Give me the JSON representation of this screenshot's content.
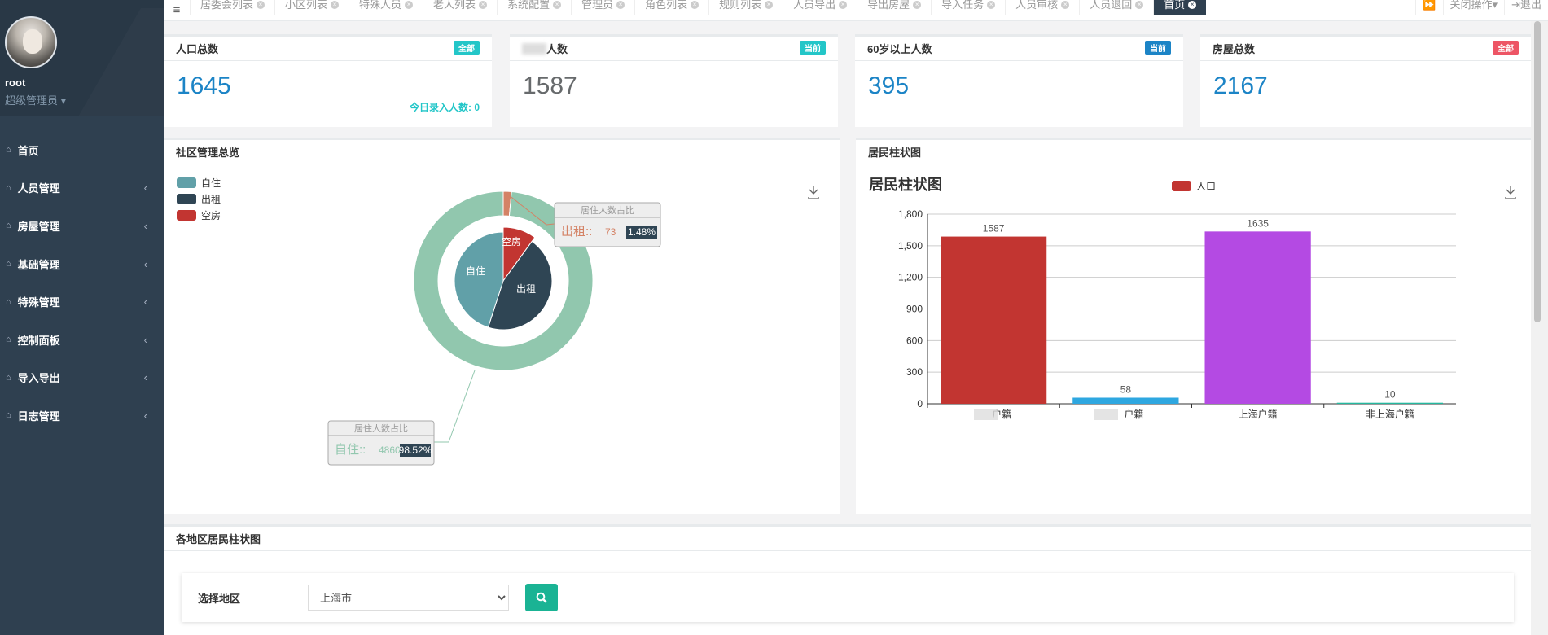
{
  "user": {
    "name": "root",
    "role": "超级管理员"
  },
  "nav": [
    {
      "label": "首页",
      "arrow": false
    },
    {
      "label": "人员管理",
      "arrow": true
    },
    {
      "label": "房屋管理",
      "arrow": true
    },
    {
      "label": "基础管理",
      "arrow": true
    },
    {
      "label": "特殊管理",
      "arrow": true
    },
    {
      "label": "控制面板",
      "arrow": true
    },
    {
      "label": "导入导出",
      "arrow": true
    },
    {
      "label": "日志管理",
      "arrow": true
    }
  ],
  "tabs": [
    "居委会列表",
    "小区列表",
    "特殊人员",
    "老人列表",
    "系统配置",
    "管理员",
    "角色列表",
    "规则列表",
    "人员导出",
    "导出房屋",
    "导入任务",
    "人员审核",
    "人员退回",
    "首页"
  ],
  "tab_tools": {
    "close_ops": "关闭操作",
    "logout": "退出"
  },
  "stats": [
    {
      "title": "人口总数",
      "badge": "全部",
      "badge_color": "#23c6c8",
      "value": "1645",
      "value_color": "#1c84c6",
      "sub": "今日录入人数:  0"
    },
    {
      "title": "人数",
      "badge": "当前",
      "badge_color": "#23c6c8",
      "value": "1587",
      "value_color": "#676a6c"
    },
    {
      "title": "60岁以上人数",
      "badge": "当前",
      "badge_color": "#1c84c6",
      "value": "395",
      "value_color": "#1c84c6"
    },
    {
      "title": "房屋总数",
      "badge": "全部",
      "badge_color": "#ed5565",
      "value": "2167",
      "value_color": "#1c84c6"
    }
  ],
  "panel_left": {
    "title": "社区管理总览"
  },
  "panel_right": {
    "title": "居民柱状图"
  },
  "panel_bottom": {
    "title": "各地区居民柱状图",
    "filter_label": "选择地区",
    "region": "上海市"
  },
  "chart_data": [
    {
      "type": "pie",
      "legend": [
        "自住",
        "出租",
        "空房"
      ],
      "colors": {
        "自住": "#61a0a8",
        "出租": "#2f4554",
        "空房": "#c23531",
        "outer": "#91c7ae",
        "outer_small": "#d48265"
      },
      "inner_labels": [
        "自住",
        "出租",
        "空房"
      ],
      "callouts": [
        {
          "title": "居住人数占比",
          "name": "出租::",
          "value": "73",
          "pct": "1.48%"
        },
        {
          "title": "居住人数占比",
          "name": "自住::",
          "value": "4860",
          "pct": "98.52%"
        }
      ],
      "outer_values": [
        4860,
        73
      ],
      "inner_values_estimated": [
        45,
        45,
        10
      ]
    },
    {
      "type": "bar",
      "title": "居民柱状图",
      "legend": "人口",
      "categories": [
        "户籍",
        "户籍",
        "上海户籍",
        "非上海户籍"
      ],
      "values": [
        1587,
        58,
        1635,
        10
      ],
      "colors": [
        "#c23531",
        "#2ea7e0",
        "#b44ae3",
        "#25b89f"
      ],
      "ylim": [
        0,
        1800
      ],
      "yticks": [
        "0",
        "300",
        "600",
        "900",
        "1,200",
        "1,500",
        "1,800"
      ]
    }
  ]
}
